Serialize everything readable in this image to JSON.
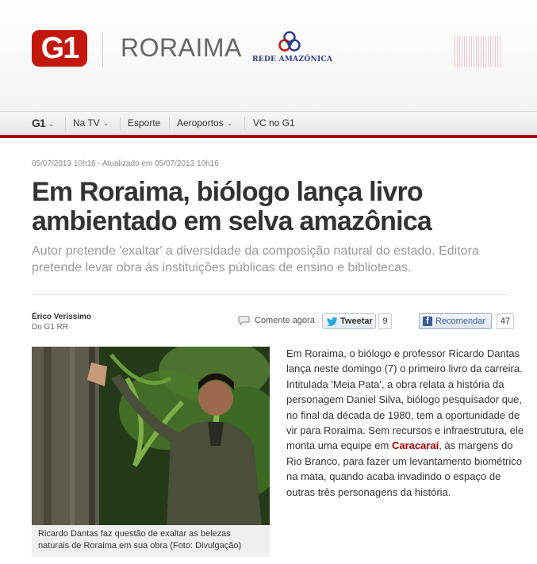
{
  "header": {
    "logo": "G1",
    "region": "RORAIMA",
    "partner_logo_text": "REDE AMAZÔNICA"
  },
  "nav": {
    "items": [
      {
        "label": "G1",
        "dropdown": true
      },
      {
        "label": "Na TV",
        "dropdown": true
      },
      {
        "label": "Esporte",
        "dropdown": false
      },
      {
        "label": "Aeroportos",
        "dropdown": true
      },
      {
        "label": "VC no G1",
        "dropdown": false
      }
    ],
    "accent_color": "#a80000"
  },
  "article": {
    "timestamp": "05/07/2013 10h16 - Atualizado em 05/07/2013 10h16",
    "headline": "Em Roraima, biólogo lança livro ambientado em selva amazônica",
    "subheadline": "Autor pretende 'exaltar' a diversidade da composição natural do estado. Editora pretende levar obra às instituições públicas de ensino e bibliotecas.",
    "author": "Érico Veríssimo",
    "source": "Do G1 RR",
    "comment_label": "Comente agora",
    "tweet_label": "Tweetar",
    "tweet_count": "9",
    "recommend_label": "Recomendar",
    "recommend_count": "47",
    "photo_caption": "Ricardo Dantas faz questão de exaltar as belezas naturais de Roraima em sua obra (Foto: Divulgação)",
    "body_before_link": "Em Roraima, o biólogo e professor Ricardo Dantas lança neste domingo (7) o primeiro livro da carreira. Intitulada 'Meia Pata', a obra relata a história da personagem Daniel Silva, biólogo pesquisador que, no final da década de 1980, tem a oportunidade de vir para Roraima. Sem recursos e infraestrutura, ele monta uma equipe em ",
    "body_link": "Caracaraí",
    "body_after_link": ", às margens do Rio Branco, para fazer um levantamento biométrico na mata, quando acaba invadindo o espaço de outras três personagens da história."
  }
}
